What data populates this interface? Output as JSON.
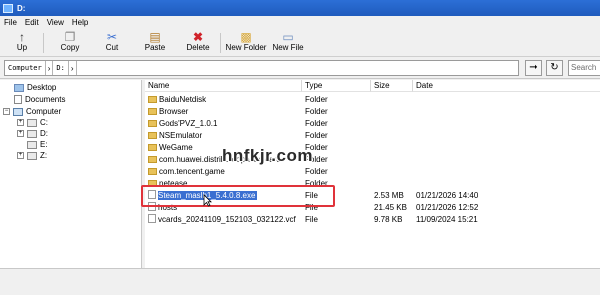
{
  "window": {
    "title": "D:"
  },
  "menu": [
    "File",
    "Edit",
    "View",
    "Help"
  ],
  "toolbar": {
    "up": "Up",
    "copy": "Copy",
    "cut": "Cut",
    "paste": "Paste",
    "delete": "Delete",
    "new_folder": "New Folder",
    "new_file": "New File"
  },
  "address": {
    "crumbs": [
      "Computer",
      "D:"
    ],
    "search_placeholder": "Search"
  },
  "tree": {
    "desktop": "Desktop",
    "documents": "Documents",
    "computer": "Computer",
    "drives": [
      "C:",
      "D:",
      "E:",
      "Z:"
    ]
  },
  "columns": {
    "name": "Name",
    "type": "Type",
    "size": "Size",
    "date": "Date"
  },
  "files": [
    {
      "name": "BaiduNetdisk",
      "type": "Folder",
      "size": "",
      "date": "",
      "icon": "folder"
    },
    {
      "name": "Browser",
      "type": "Folder",
      "size": "",
      "date": "",
      "icon": "folder"
    },
    {
      "name": "Gods'PVZ_1.0.1",
      "type": "Folder",
      "size": "",
      "date": "",
      "icon": "folder"
    },
    {
      "name": "NSEmulator",
      "type": "Folder",
      "size": "",
      "date": "",
      "icon": "folder"
    },
    {
      "name": "WeGame",
      "type": "Folder",
      "size": "",
      "date": "",
      "icon": "folder"
    },
    {
      "name": "com.huawei.distributedpasteboard",
      "type": "Folder",
      "size": "",
      "date": "",
      "icon": "folder"
    },
    {
      "name": "com.tencent.game",
      "type": "Folder",
      "size": "",
      "date": "",
      "icon": "folder"
    },
    {
      "name": "netease",
      "type": "Folder",
      "size": "",
      "date": "",
      "icon": "folder"
    },
    {
      "name": "Steam_maslb1_5.4.0.8.exe",
      "type": "File",
      "size": "2.53 MB",
      "date": "01/21/2026 14:40",
      "icon": "file",
      "selected": true
    },
    {
      "name": "hosts",
      "type": "File",
      "size": "21.45 KB",
      "date": "01/21/2026 12:52",
      "icon": "file"
    },
    {
      "name": "vcards_20241109_152103_032122.vcf",
      "type": "File",
      "size": "9.78 KB",
      "date": "11/09/2024 15:21",
      "icon": "file"
    }
  ],
  "watermark": "hnfkjr.com",
  "colors": {
    "highlight_box": "#e0333a",
    "selection": "#3a6fd1",
    "titlebar": "#2c6fd6"
  }
}
